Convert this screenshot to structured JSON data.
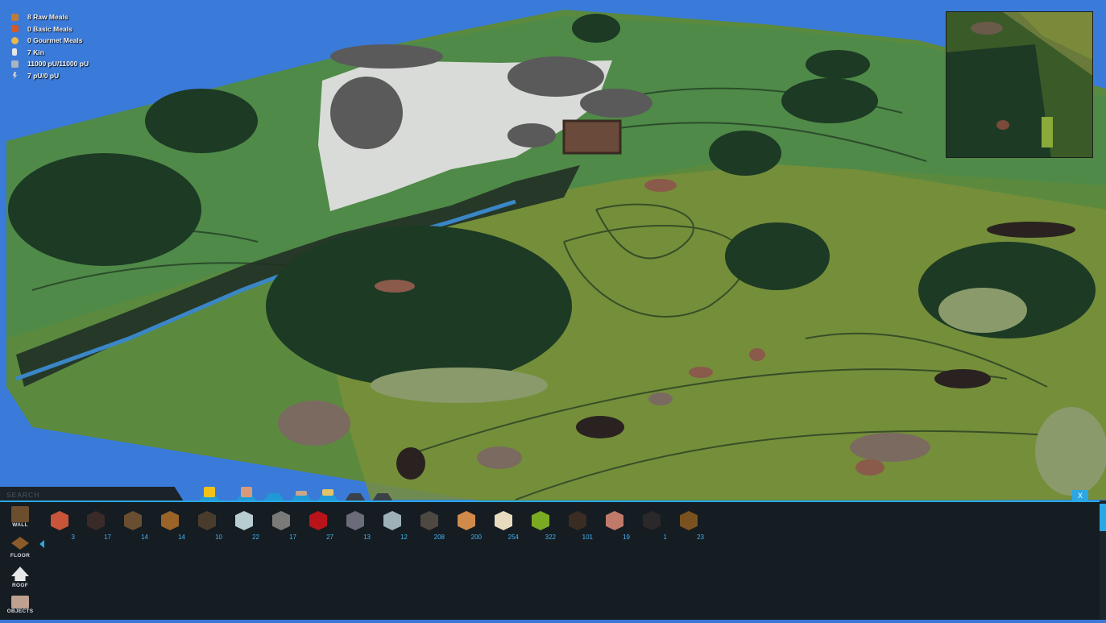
{
  "hud": {
    "rows": [
      {
        "icon": "raw-meal-icon",
        "text": "8 Raw Meals",
        "color": "#c07a3a"
      },
      {
        "icon": "basic-meal-icon",
        "text": "0 Basic Meals",
        "color": "#d05a2a"
      },
      {
        "icon": "gourmet-meal-icon",
        "text": "0 Gourmet Meals",
        "color": "#e8b850"
      },
      {
        "icon": "kin-icon",
        "text": "7 Kin",
        "color": "#e6e6e6"
      },
      {
        "icon": "power-storage-icon",
        "text": "11000 pU/11000 pU",
        "color": "#a9b4c0"
      },
      {
        "icon": "power-usage-icon",
        "text": "7 pU/0 pU",
        "color": "#d0d0d0"
      }
    ]
  },
  "minimap": {
    "zoom_out_label": "-",
    "zoom_in_label": "+"
  },
  "build_bar": {
    "search_placeholder": "SEARCH",
    "close_label": "X",
    "category_tabs": [
      {
        "name": "tab-machines",
        "icon_color": "#f2c21a"
      },
      {
        "name": "tab-stone",
        "icon_color": "#d99a7a"
      },
      {
        "name": "tab-blank",
        "icon_color": "#1f9ad6"
      },
      {
        "name": "tab-planks",
        "icon_color": "#c9a58a"
      },
      {
        "name": "tab-tools",
        "icon_color": "#e3c36a"
      },
      {
        "name": "tab-inactive-1",
        "icon_color": "#3a4148"
      },
      {
        "name": "tab-inactive-2",
        "icon_color": "#3a4148"
      }
    ],
    "categories": [
      {
        "label": "Wall",
        "icon": "wall-cube-icon",
        "color": "#6b4e2e"
      },
      {
        "label": "Floor",
        "icon": "floor-tile-icon",
        "color": "#8a5a2a"
      },
      {
        "label": "Roof",
        "icon": "roof-icon",
        "color": "#e8e8e8"
      },
      {
        "label": "Objects",
        "icon": "objects-icon",
        "color": "#c0a090"
      }
    ],
    "materials": [
      {
        "count": "3",
        "color": "#c8543a"
      },
      {
        "count": "17",
        "color": "#3a2a28"
      },
      {
        "count": "14",
        "color": "#6a4e32"
      },
      {
        "count": "14",
        "color": "#9a6428"
      },
      {
        "count": "10",
        "color": "#4a3c2c"
      },
      {
        "count": "22",
        "color": "#b8cdd2"
      },
      {
        "count": "17",
        "color": "#7a7a78"
      },
      {
        "count": "27",
        "color": "#b8141a"
      },
      {
        "count": "13",
        "color": "#6a6c7a"
      },
      {
        "count": "12",
        "color": "#9eb0b8"
      },
      {
        "count": "208",
        "color": "#4e4843"
      },
      {
        "count": "200",
        "color": "#d08a4a"
      },
      {
        "count": "254",
        "color": "#e8dcc0"
      },
      {
        "count": "322",
        "color": "#7aaa22"
      },
      {
        "count": "101",
        "color": "#3a2c22"
      },
      {
        "count": "19",
        "color": "#c07a6a"
      },
      {
        "count": "1",
        "color": "#2a2828"
      },
      {
        "count": "23",
        "color": "#7a5220"
      }
    ]
  }
}
